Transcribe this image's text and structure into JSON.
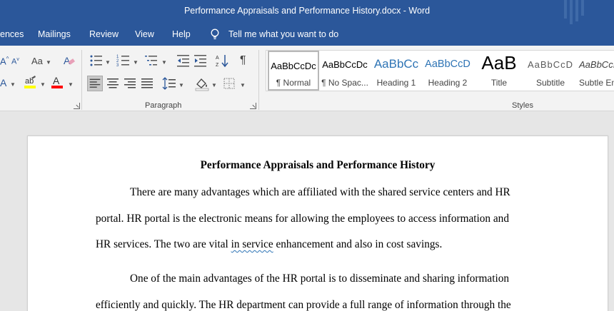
{
  "window": {
    "title": "Performance Appraisals and Performance History.docx  -  Word"
  },
  "menu": {
    "tabs": [
      "ences",
      "Mailings",
      "Review",
      "View",
      "Help"
    ],
    "tell_me": "Tell me what you want to do"
  },
  "ribbon": {
    "paragraph_label": "Paragraph",
    "styles_label": "Styles",
    "font_size_glyph": "Aa",
    "styles": [
      {
        "preview": "AaBbCcDc",
        "name": "¶ Normal"
      },
      {
        "preview": "AaBbCcDc",
        "name": "¶ No Spac..."
      },
      {
        "preview": "AaBbCc",
        "name": "Heading 1"
      },
      {
        "preview": "AaBbCcD",
        "name": "Heading 2"
      },
      {
        "preview": "AaB",
        "name": "Title"
      },
      {
        "preview": "AaBbCcD",
        "name": "Subtitle"
      },
      {
        "preview": "AaBbCcI",
        "name": "Subtle Em"
      }
    ],
    "colors": {
      "highlight": "#ffff00",
      "font_color": "#ff0000",
      "accent": "#2b579a"
    }
  },
  "document": {
    "title": "Performance Appraisals and Performance History",
    "lines": [
      "There are many advantages which are affiliated with the shared service centers and HR",
      "portal. HR portal is the electronic means for allowing the employees to access information and",
      "HR services. The two are vital ",
      "in service",
      " enhancement and also in cost savings.",
      "One of the main advantages of the HR portal is to disseminate and sharing information",
      "efficiently and quickly. The HR department can provide a full range of information through the"
    ]
  }
}
